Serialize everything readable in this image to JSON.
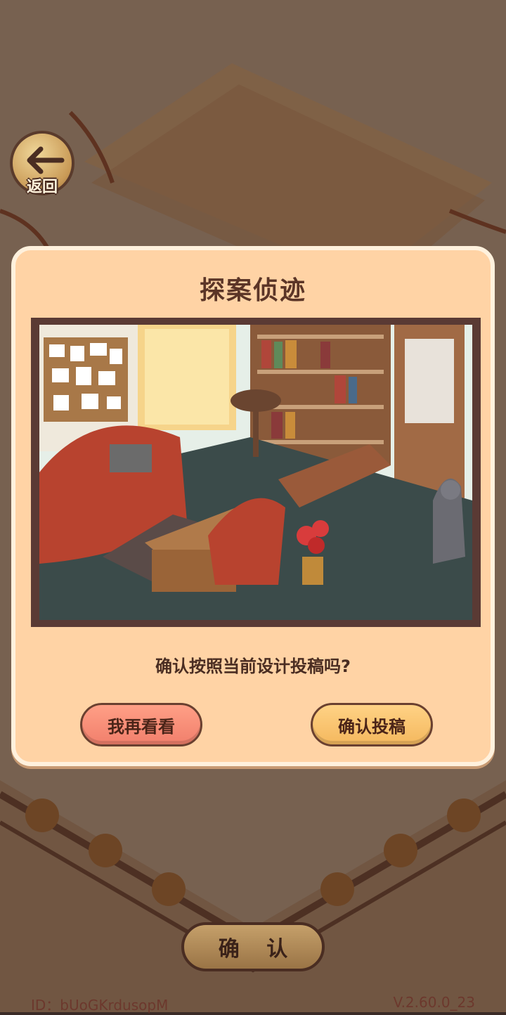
{
  "back": {
    "label": "返回"
  },
  "dialog": {
    "title": "探案侦迹",
    "question": "确认按照当前设计投稿吗?",
    "cancel_label": "我再看看",
    "confirm_label": "确认投稿"
  },
  "footer": {
    "confirm_label": "确 认",
    "user_id": "ID：bUoGKrdusopM",
    "version": "V.2.60.0_23"
  },
  "colors": {
    "dialog_bg": "#ffd3a5",
    "title_text": "#5b3527",
    "cancel_button": "#f17f6c",
    "confirm_button": "#f4b85e"
  }
}
